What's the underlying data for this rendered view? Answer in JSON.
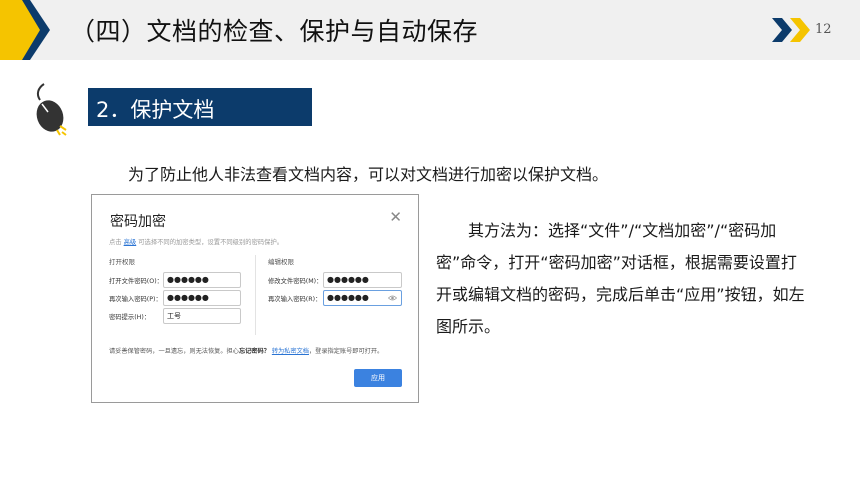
{
  "header": {
    "title": "（四）文档的检查、保护与自动保存",
    "page_number": "12",
    "colors": {
      "accent_yellow": "#f5c400",
      "accent_blue": "#0c3b6b",
      "bar_bg": "#f0f0f0"
    }
  },
  "section": {
    "label": "2．保护文档",
    "icon": "computer-mouse-icon"
  },
  "intro_text": "为了防止他人非法查看文档内容，可以对文档进行加密以保护文档。",
  "dialog": {
    "title": "密码加密",
    "close_icon": "close-icon",
    "hint_prefix": "点击",
    "hint_link": "高级",
    "hint_suffix": "可选择不同的加密类型，设置不同级别的密码保护。",
    "open_section": {
      "heading": "打开权限",
      "password_label": "打开文件密码(O)：",
      "password_value": "●●●●●●",
      "confirm_label": "再次输入密码(P)：",
      "confirm_value": "●●●●●●",
      "hint_label": "密码提示(H)：",
      "hint_value": "工号"
    },
    "edit_section": {
      "heading": "编辑权限",
      "password_label": "修改文件密码(M)：",
      "password_value": "●●●●●●",
      "confirm_label": "再次输入密码(R)：",
      "confirm_value": "●●●●●●"
    },
    "note_prefix": "请妥善保管密码，一旦遗忘，则无法恢复。担心",
    "note_bold": "忘记密码？",
    "note_link": "转为私密文档",
    "note_suffix": "，登录指定账号即可打开。",
    "apply_label": "应用"
  },
  "description": "其方法为：选择“文件”/“文档加密”/“密码加密”命令，打开“密码加密”对话框，根据需要设置打开或编辑文档的密码，完成后单击“应用”按钮，如左图所示。"
}
